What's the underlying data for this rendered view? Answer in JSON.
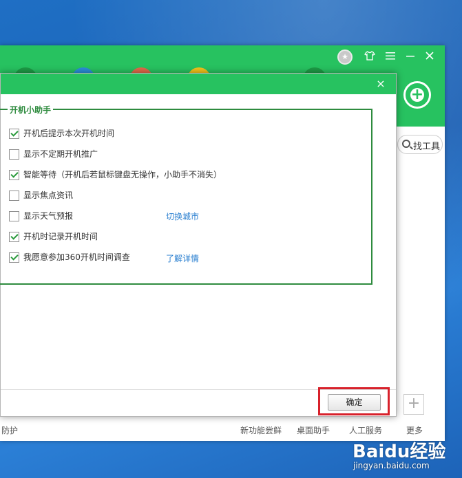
{
  "main_window": {
    "search_placeholder": "找工具",
    "bottom_bar": {
      "left_text": "防护",
      "items": [
        "新功能尝鲜",
        "桌面助手",
        "人工服务",
        "更多"
      ]
    },
    "add_tool_label": "+",
    "top_icon_colors": [
      "#1d9b45",
      "#2a8fd8",
      "#e06a4a",
      "#f2c31a",
      "#1d9b45"
    ]
  },
  "dialog": {
    "close_glyph": "×",
    "group_title": "开机小助手",
    "options": [
      {
        "label": "开机后提示本次开机时间",
        "checked": true
      },
      {
        "label": "显示不定期开机推广",
        "checked": false
      },
      {
        "label": "智能等待（开机后若鼠标键盘无操作，小助手不消失）",
        "checked": true
      },
      {
        "label": "显示焦点资讯",
        "checked": false
      },
      {
        "label": "显示天气预报",
        "checked": false,
        "link": "切换城市"
      },
      {
        "label": "开机时记录开机时间",
        "checked": true
      },
      {
        "label": "我愿意参加360开机时间调查",
        "checked": true,
        "link": "了解详情"
      }
    ],
    "ok_label": "确定"
  },
  "watermark": {
    "logo": "Baidu经验",
    "url": "jingyan.baidu.com"
  },
  "colors": {
    "brand_green": "#27c260",
    "group_border": "#2e8b3e",
    "link_blue": "#2a7fd0",
    "highlight_red": "#d8212b"
  }
}
